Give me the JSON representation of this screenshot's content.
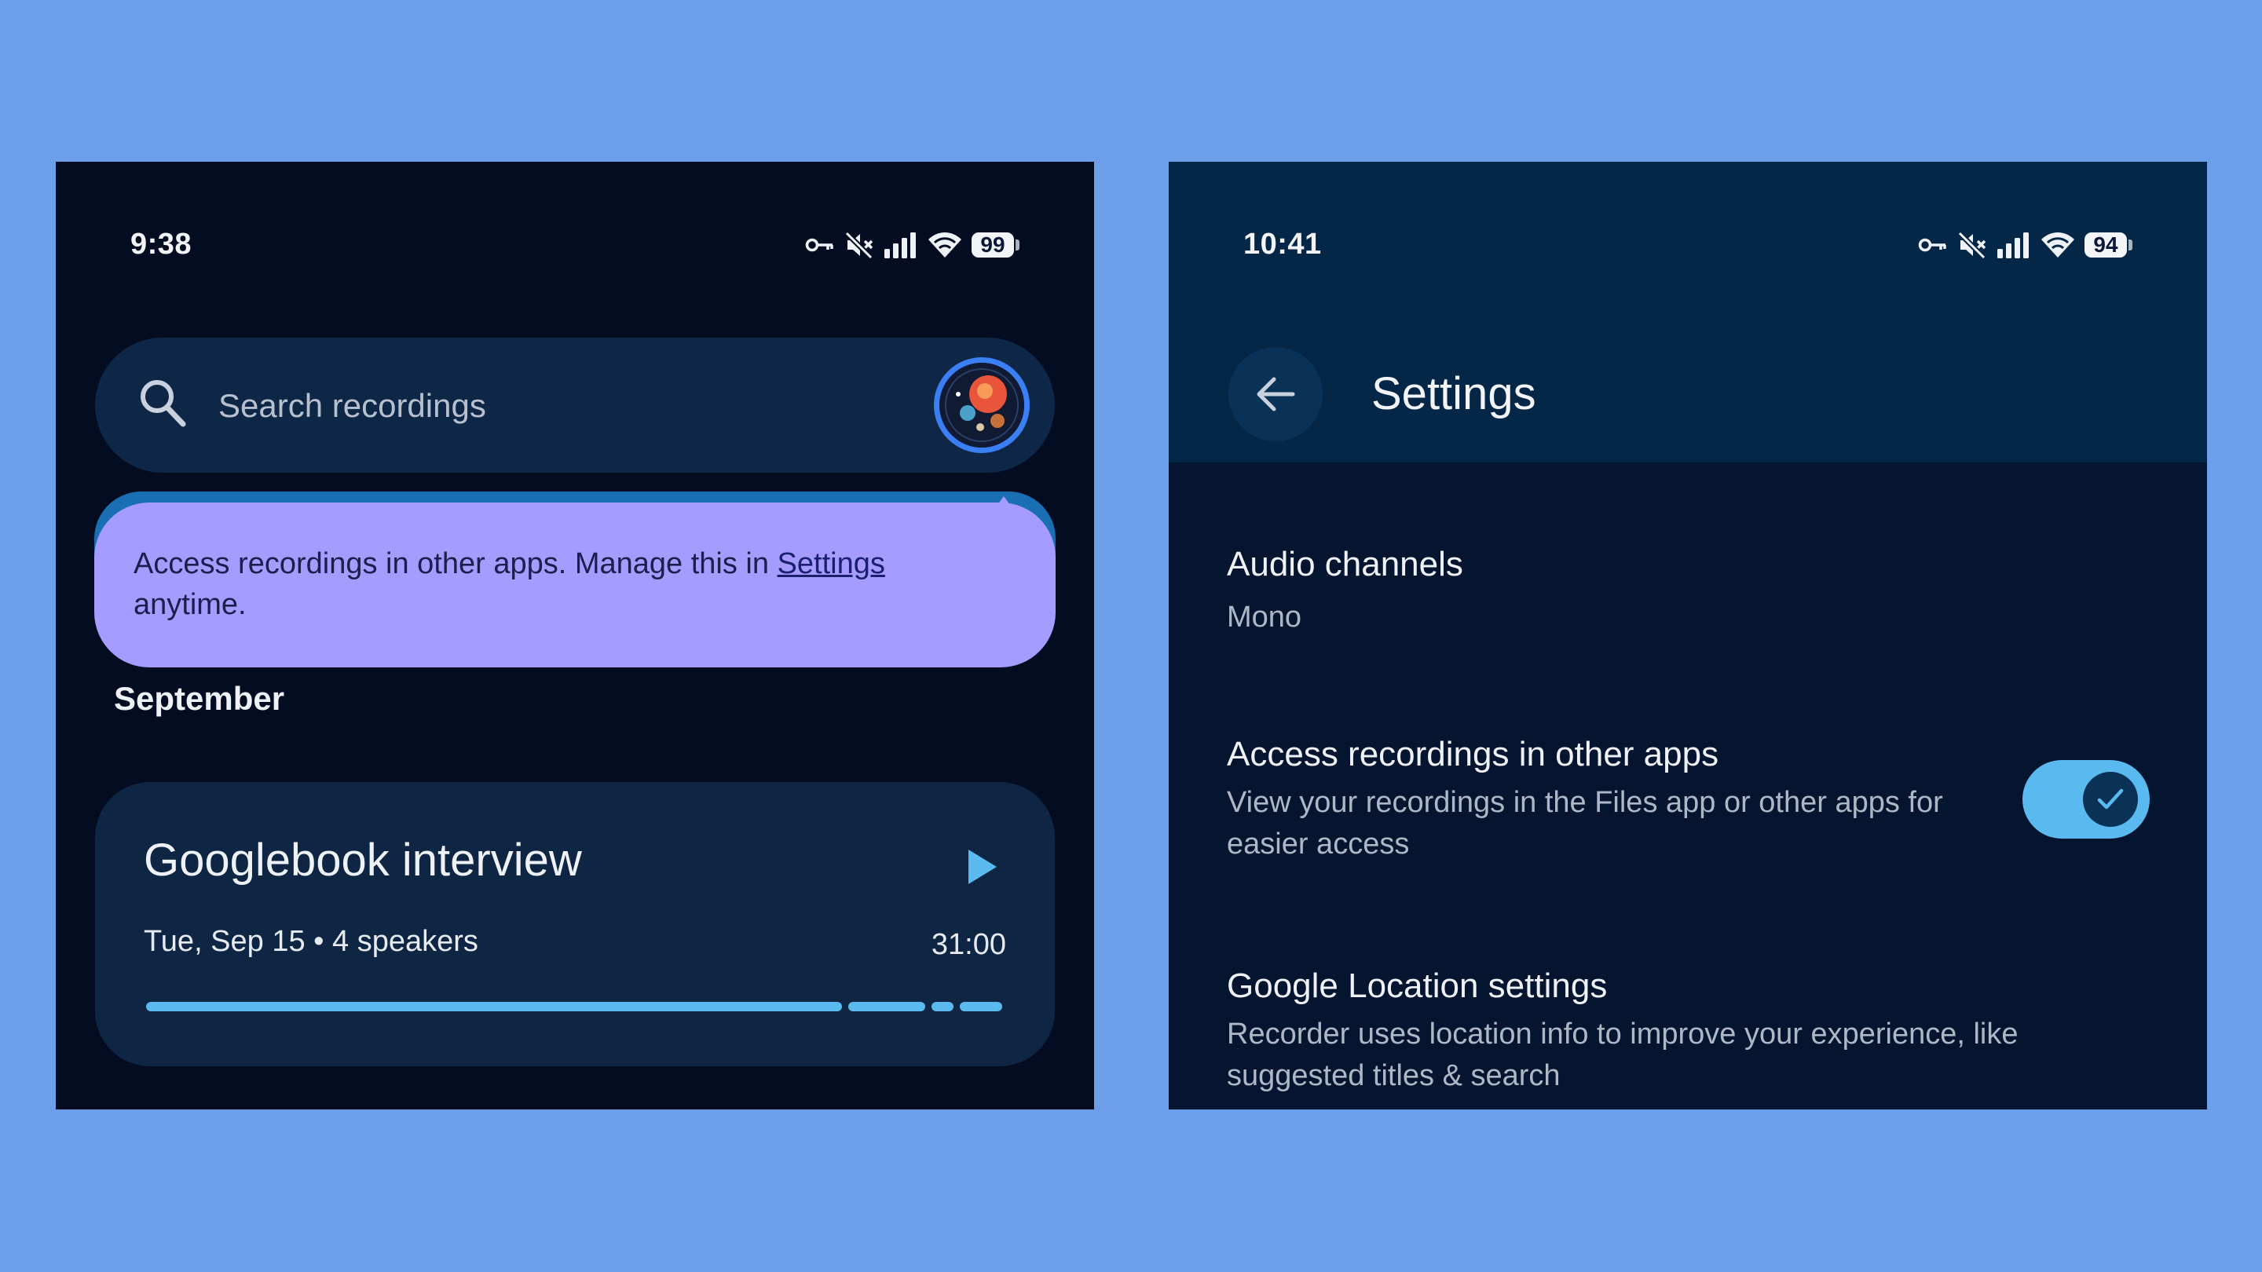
{
  "left_screen": {
    "status_bar": {
      "time": "9:38",
      "battery": "99"
    },
    "search": {
      "placeholder": "Search recordings"
    },
    "tooltip": {
      "text": "Access recordings in other apps. Manage this in ",
      "link": "Settings",
      "text_after": "anytime."
    },
    "section_label": "September",
    "recording": {
      "title": "Googlebook interview",
      "meta": "Tue, Sep 15 • 4 speakers",
      "duration": "31:00"
    }
  },
  "right_screen": {
    "status_bar": {
      "time": "10:41",
      "battery": "94"
    },
    "header": {
      "title": "Settings"
    },
    "settings": [
      {
        "title": "Audio channels",
        "subtitle": "Mono"
      },
      {
        "title": "Access recordings in other apps",
        "subtitle": "View your recordings in the Files app or other apps for easier access",
        "toggle_on": true
      },
      {
        "title": "Google Location settings",
        "subtitle": "Recorder uses location info to improve your experience, like suggested titles & search"
      }
    ]
  },
  "icons": {
    "status": [
      "vpn-key-icon",
      "mute-icon",
      "signal-icon",
      "wifi-icon",
      "battery-icon"
    ],
    "search": "search-icon",
    "play": "play-icon",
    "back": "arrow-back-icon",
    "toggle": "check-icon"
  },
  "colors": {
    "background": "#6d9eea",
    "left_panel": "#040c22",
    "right_panel": "#051530",
    "tooltip": "#a69bff",
    "accent": "#5ab9ee",
    "avatar_ring": "#3b7ff5"
  }
}
